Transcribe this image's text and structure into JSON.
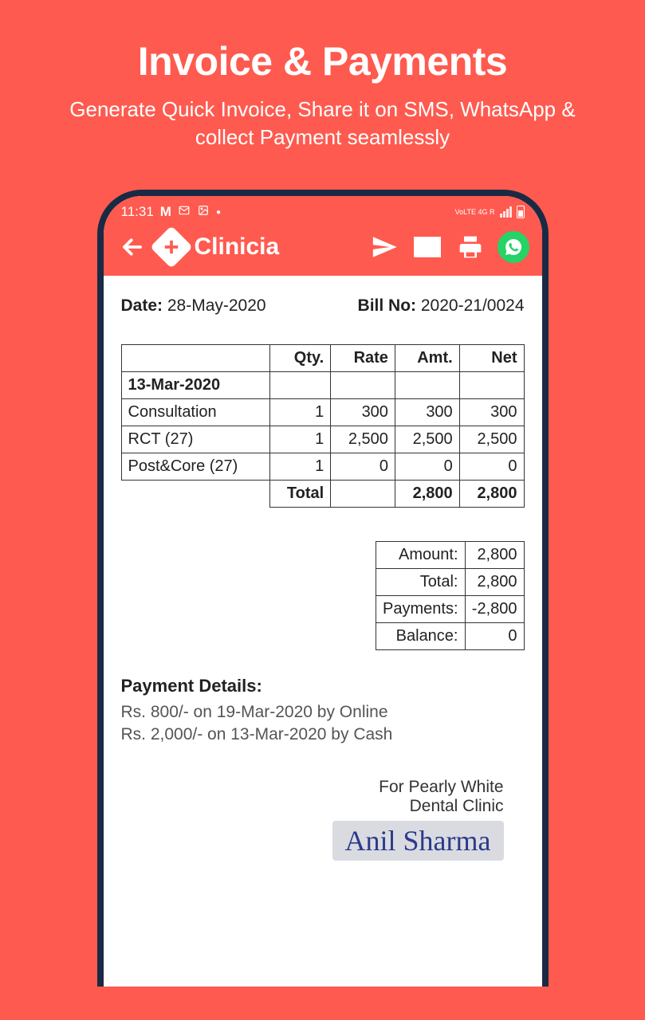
{
  "marketing": {
    "title": "Invoice & Payments",
    "subtitle": "Generate Quick Invoice, Share it on SMS, WhatsApp & collect Payment seamlessly"
  },
  "status_bar": {
    "time": "11:31",
    "network_label": "VoLTE 4G R"
  },
  "app": {
    "title": "Clinicia"
  },
  "invoice": {
    "date_label": "Date:",
    "date_value": "28-May-2020",
    "bill_label": "Bill No:",
    "bill_value": "2020-21/0024",
    "columns": [
      "",
      "Qty.",
      "Rate",
      "Amt.",
      "Net"
    ],
    "group_date": "13-Mar-2020",
    "rows": [
      {
        "name": "Consultation",
        "qty": "1",
        "rate": "300",
        "amt": "300",
        "net": "300"
      },
      {
        "name": "RCT (27)",
        "qty": "1",
        "rate": "2,500",
        "amt": "2,500",
        "net": "2,500"
      },
      {
        "name": "Post&Core (27)",
        "qty": "1",
        "rate": "0",
        "amt": "0",
        "net": "0"
      }
    ],
    "total_label": "Total",
    "total_amt": "2,800",
    "total_net": "2,800",
    "summary": [
      {
        "label": "Amount:",
        "value": "2,800"
      },
      {
        "label": "Total:",
        "value": "2,800"
      },
      {
        "label": "Payments:",
        "value": "-2,800"
      },
      {
        "label": "Balance:",
        "value": "0"
      }
    ],
    "payment_heading": "Payment Details:",
    "payments": [
      "Rs. 800/- on 19-Mar-2020 by Online",
      "Rs. 2,000/- on 13-Mar-2020 by Cash"
    ],
    "sign_for_1": "For Pearly White",
    "sign_for_2": "Dental Clinic",
    "signature_name": "Anil Sharma"
  }
}
